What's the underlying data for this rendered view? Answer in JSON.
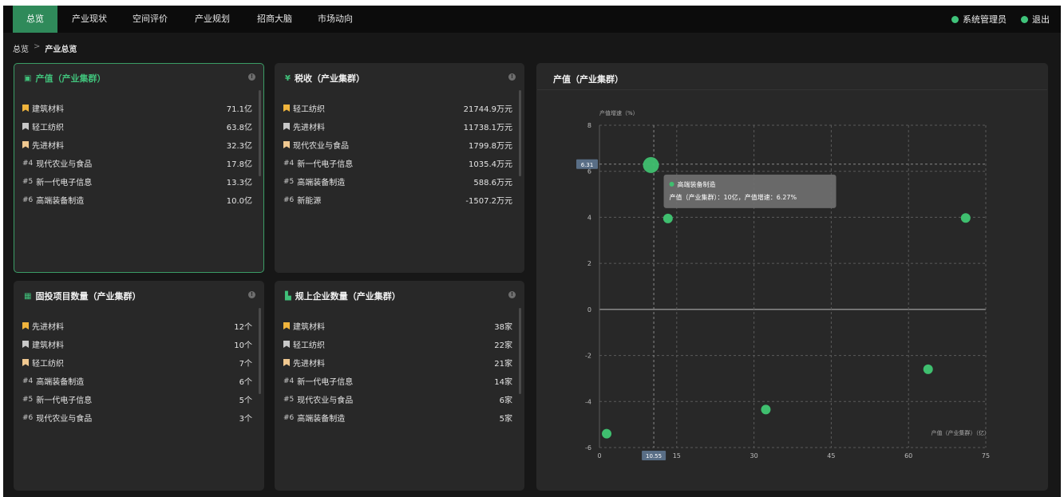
{
  "nav": {
    "items": [
      "总览",
      "产业现状",
      "空间评价",
      "产业规划",
      "招商大脑",
      "市场动向"
    ],
    "active_index": 0
  },
  "user": {
    "admin": "系统管理员",
    "logout": "退出"
  },
  "breadcrumb": {
    "root": "总览",
    "separator": ">",
    "current": "产业总览"
  },
  "panels": {
    "output": {
      "title": "产值（产业集群）",
      "icon": "building-icon",
      "rows": [
        {
          "rank": "",
          "name": "建筑材料",
          "value": "71.1亿"
        },
        {
          "rank": "",
          "name": "轻工纺织",
          "value": "63.8亿"
        },
        {
          "rank": "",
          "name": "先进材料",
          "value": "32.3亿"
        },
        {
          "rank": "#4",
          "name": "现代农业与食品",
          "value": "17.8亿"
        },
        {
          "rank": "#5",
          "name": "新一代电子信息",
          "value": "13.3亿"
        },
        {
          "rank": "#6",
          "name": "高端装备制造",
          "value": "10.0亿"
        }
      ]
    },
    "tax": {
      "title": "税收（产业集群）",
      "icon": "yen-icon",
      "rows": [
        {
          "rank": "",
          "name": "轻工纺织",
          "value": "21744.9万元"
        },
        {
          "rank": "",
          "name": "先进材料",
          "value": "11738.1万元"
        },
        {
          "rank": "",
          "name": "现代农业与食品",
          "value": "1799.8万元"
        },
        {
          "rank": "#4",
          "name": "新一代电子信息",
          "value": "1035.4万元"
        },
        {
          "rank": "#5",
          "name": "高端装备制造",
          "value": "588.6万元"
        },
        {
          "rank": "#6",
          "name": "新能源",
          "value": "-1507.2万元"
        }
      ]
    },
    "projects": {
      "title": "固投项目数量（产业集群）",
      "icon": "grid-icon",
      "rows": [
        {
          "rank": "",
          "name": "先进材料",
          "value": "12个"
        },
        {
          "rank": "",
          "name": "建筑材料",
          "value": "10个"
        },
        {
          "rank": "",
          "name": "轻工纺织",
          "value": "7个"
        },
        {
          "rank": "#4",
          "name": "高端装备制造",
          "value": "6个"
        },
        {
          "rank": "#5",
          "name": "新一代电子信息",
          "value": "5个"
        },
        {
          "rank": "#6",
          "name": "现代农业与食品",
          "value": "3个"
        }
      ]
    },
    "enterprises": {
      "title": "规上企业数量（产业集群）",
      "icon": "bar-chart-icon",
      "rows": [
        {
          "rank": "",
          "name": "建筑材料",
          "value": "38家"
        },
        {
          "rank": "",
          "name": "轻工纺织",
          "value": "22家"
        },
        {
          "rank": "",
          "name": "先进材料",
          "value": "21家"
        },
        {
          "rank": "#4",
          "name": "新一代电子信息",
          "value": "14家"
        },
        {
          "rank": "#5",
          "name": "现代农业与食品",
          "value": "6家"
        },
        {
          "rank": "#6",
          "name": "高端装备制造",
          "value": "5家"
        }
      ]
    }
  },
  "chart_panel": {
    "title": "产值（产业集群）"
  },
  "chart_data": {
    "type": "scatter",
    "ylabel": "产值增速（%）",
    "xlabel": "产值（产业集群）（亿）",
    "xlim": [
      0,
      75
    ],
    "ylim": [
      -6,
      8
    ],
    "xticks": [
      0,
      15,
      30,
      45,
      60,
      75
    ],
    "yticks": [
      8,
      6,
      4,
      2,
      0,
      -2,
      -4,
      -6
    ],
    "points": [
      {
        "x": 10.0,
        "y": 6.27,
        "highlight": true
      },
      {
        "x": 13.3,
        "y": 3.95
      },
      {
        "x": 71.1,
        "y": 3.97
      },
      {
        "x": 63.8,
        "y": -2.6
      },
      {
        "x": 32.3,
        "y": -4.35
      },
      {
        "x": 1.4,
        "y": -5.4
      }
    ],
    "pointer": {
      "x": "10.55",
      "y": "6.31"
    },
    "tooltip": {
      "name": "高端装备制造",
      "text": "产值（产业集群）：10亿，产值增速：6.27%"
    },
    "color": "#3fbf6f",
    "grid": true
  }
}
